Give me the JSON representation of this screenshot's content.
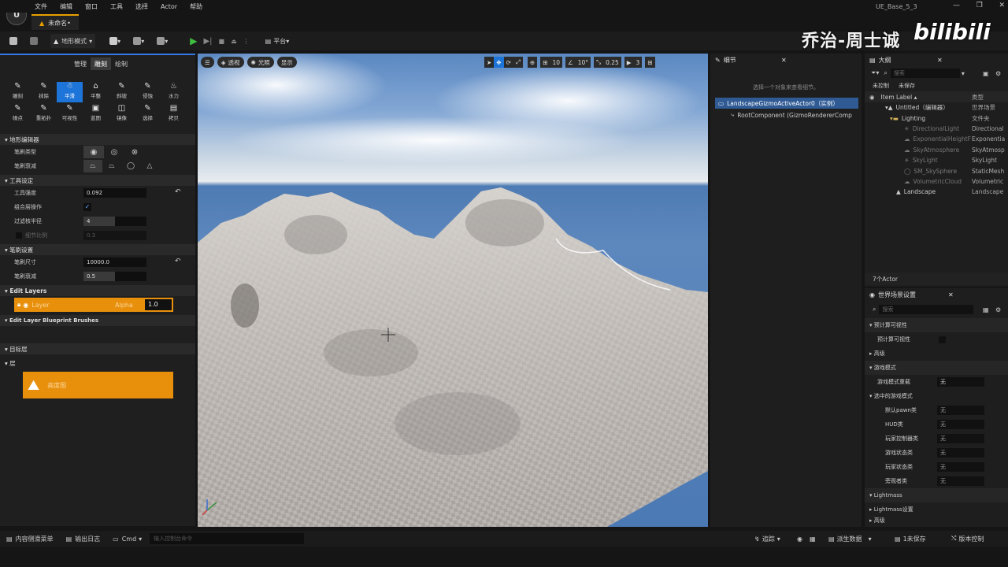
{
  "menubar": {
    "items": [
      "文件",
      "编辑",
      "窗口",
      "工具",
      "选择",
      "Actor",
      "帮助"
    ],
    "project": "UE_Base_5_3",
    "logo_text": "U"
  },
  "tab": {
    "title": "未命名•"
  },
  "toolbar": {
    "mode": "地形模式",
    "platform": "平台"
  },
  "watermark": {
    "author": "乔治-周士诚",
    "logo": "bilibili"
  },
  "landscape": {
    "mode_tabs": [
      "管理",
      "雕刻",
      "绘制"
    ],
    "tools_row1": [
      "雕刻",
      "抹除",
      "平滑",
      "平整",
      "斜坡",
      "侵蚀",
      "水力"
    ],
    "tools_row2": [
      "噪点",
      "重拓扑",
      "可视性",
      "蓝图",
      "镜像",
      "选择",
      "拷贝"
    ],
    "section_editor": "地形编辑器",
    "brush_type": "笔刷类型",
    "brush_falloff": "笔刷衰减",
    "section_tool": "工具设定",
    "tool_strength_label": "工具强度",
    "tool_strength": "0.092",
    "combined_label": "组合层操作",
    "filter_radius_label": "过滤核半径",
    "filter_radius": "4",
    "detail_scale_label": "细节比例",
    "detail_scale": "0.3",
    "section_brush": "笔刷设置",
    "brush_size_label": "笔刷尺寸",
    "brush_size": "10000.0",
    "brush_falloff_label": "笔刷衰减",
    "brush_falloff_val": "0.5",
    "section_layers": "Edit Layers",
    "layer_name": "Layer",
    "alpha_label": "Alpha",
    "alpha_val": "1.0",
    "section_bp": "Edit Layer Blueprint Brushes",
    "section_target": "目标层",
    "layers_label": "层",
    "layer_item": "高度图"
  },
  "viewport": {
    "perspective": "透视",
    "lit": "光照",
    "show": "显示",
    "grid": "10",
    "angle": "10°",
    "scale": "0.25",
    "cam": "3"
  },
  "details": {
    "tab": "细节",
    "hint": "选择一个对象来查看细节。",
    "actor": "LandscapeGizmoActiveActor0（实例）",
    "component": "RootComponent (GizmoRendererComp"
  },
  "outliner": {
    "tab": "大纲",
    "search": "搜索",
    "unsaved": "未控制",
    "unsaved2": "未保存",
    "col_label": "Item Label ▴",
    "col_type": "类型",
    "rows": [
      {
        "label": "Untitled（编辑器）",
        "type": "世界场景"
      },
      {
        "label": "Lighting",
        "type": "文件夹"
      },
      {
        "label": "DirectionalLight",
        "type": "Directional"
      },
      {
        "label": "ExponentialHeightF",
        "type": "Exponentia"
      },
      {
        "label": "SkyAtmosphere",
        "type": "SkyAtmosp"
      },
      {
        "label": "SkyLight",
        "type": "SkyLight"
      },
      {
        "label": "SM_SkySphere",
        "type": "StaticMesh"
      },
      {
        "label": "VolumetricCloud",
        "type": "Volumetric"
      },
      {
        "label": "Landscape",
        "type": "Landscape"
      }
    ],
    "count": "7个Actor"
  },
  "world": {
    "tab": "世界场景设置",
    "search": "搜索",
    "sec_precompute": "预计算可视性",
    "precompute_label": "预计算可视性",
    "sec_advanced": "高级",
    "sec_gamemode": "游戏模式",
    "gamemode_override": "游戏模式重载",
    "gamemode_val": "无",
    "sec_selected": "选中的游戏模式",
    "rows": [
      {
        "label": "默认pawn类",
        "val": "无"
      },
      {
        "label": "HUD类",
        "val": "无"
      },
      {
        "label": "玩家控制器类",
        "val": "无"
      },
      {
        "label": "游戏状态类",
        "val": "无"
      },
      {
        "label": "玩家状态类",
        "val": "无"
      },
      {
        "label": "旁观者类",
        "val": "无"
      }
    ],
    "sec_lightmass": "Lightmass",
    "lightmass_settings": "Lightmass设置",
    "sec_more": "高级"
  },
  "statusbar": {
    "content_drawer": "内容侧滑菜单",
    "output_log": "输出日志",
    "cmd": "Cmd",
    "cmd_placeholder": "输入控制台命令",
    "trace": "追踪",
    "derived": "派生数据",
    "unsaved": "1未保存",
    "source_control": "版本控制"
  }
}
